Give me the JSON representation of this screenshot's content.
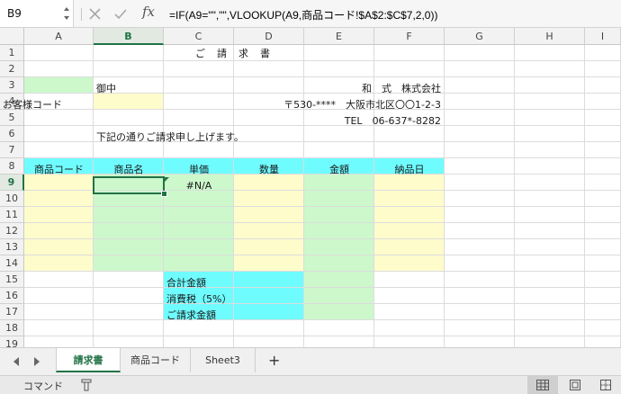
{
  "formula_bar": {
    "name_box": "B9",
    "fx": "fx",
    "formula": "=IF(A9=\"\",\"\",VLOOKUP(A9,商品コード!$A$2:$C$7,2,0))"
  },
  "columns": [
    "A",
    "B",
    "C",
    "D",
    "E",
    "F",
    "G",
    "H",
    "I"
  ],
  "rows": [
    "1",
    "2",
    "3",
    "4",
    "5",
    "6",
    "7",
    "8",
    "9",
    "10",
    "11",
    "12",
    "13",
    "14",
    "15",
    "16",
    "17",
    "18",
    "19"
  ],
  "invoice": {
    "title": "ご　請　求　書",
    "onchu": "御中",
    "customer_code_label": "お客様コード",
    "company": "和　式　株式会社",
    "address": "〒530-****　大阪市北区〇〇1-2-3",
    "tel": "TEL　06-637*-8282",
    "intro": "下記の通りご請求申し上げます。",
    "headers": {
      "code": "商品コード",
      "name": "商品名",
      "price": "単価",
      "qty": "数量",
      "amount": "金額",
      "date": "納品日"
    },
    "error_value": "#N/A",
    "subtotal_label": "合計金額",
    "tax_label": "消費税（5%）",
    "total_label": "ご請求金額"
  },
  "sheet_tabs": [
    {
      "label": "請求書",
      "active": true
    },
    {
      "label": "商品コード",
      "active": false
    },
    {
      "label": "Sheet3",
      "active": false
    }
  ],
  "tab_add": "+",
  "status": {
    "mode": "コマンド"
  },
  "colors": {
    "accent": "#217346",
    "header_cyan": "#6ffcff",
    "input_yellow": "#fffccc",
    "calc_green": "#ccf8cc"
  }
}
